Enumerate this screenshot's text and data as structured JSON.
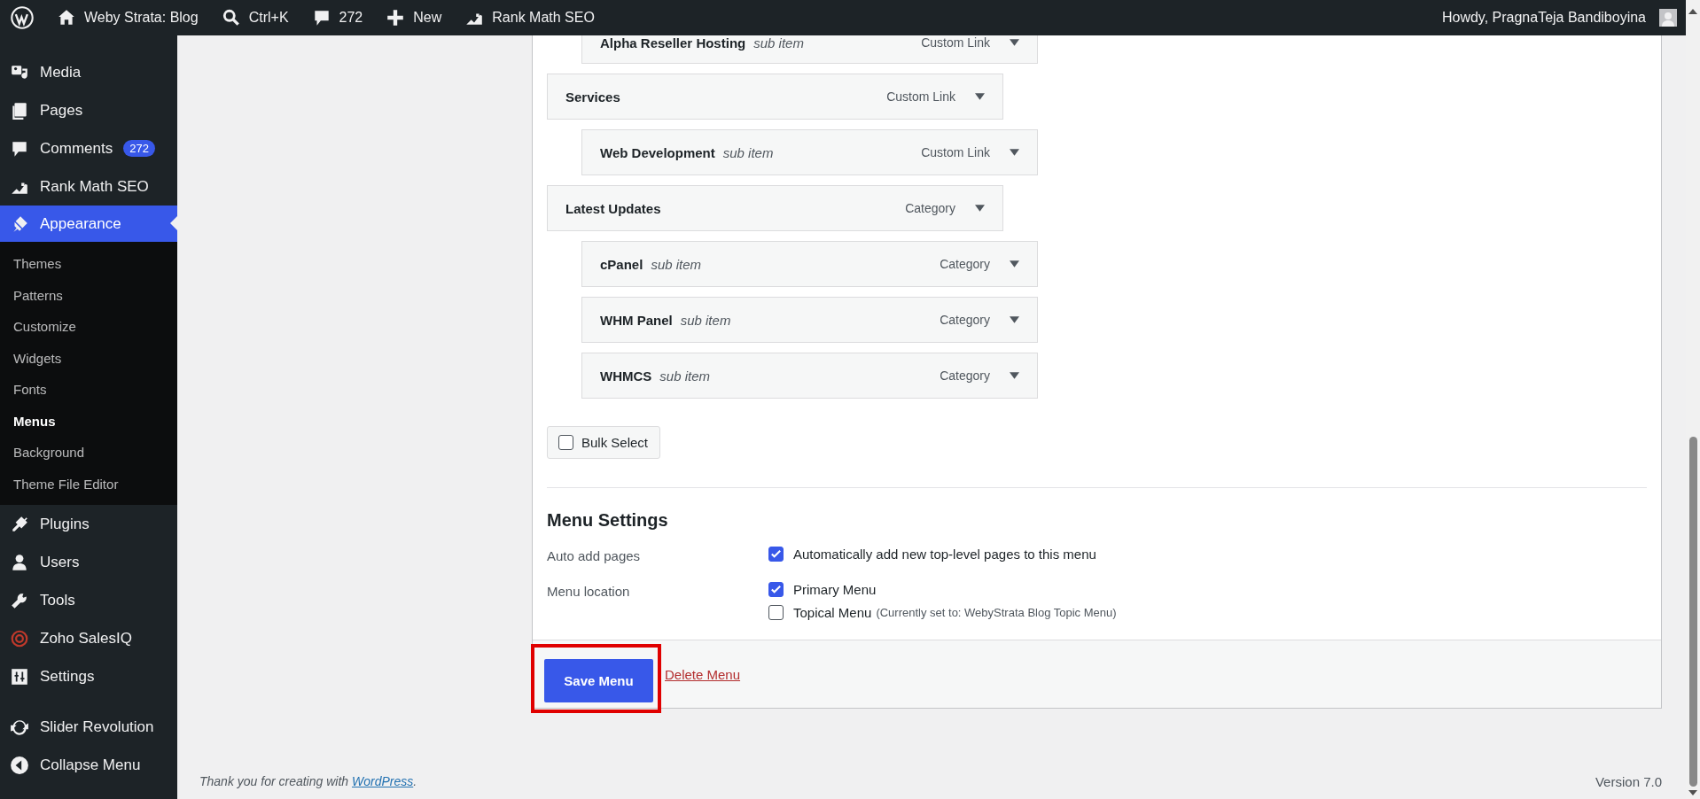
{
  "admin_bar": {
    "site": "Weby Strata: Blog",
    "search": "Ctrl+K",
    "comments": "272",
    "new": "New",
    "seo": "Rank Math SEO",
    "greeting": "Howdy, PragnaTeja Bandiboyina"
  },
  "sidebar": {
    "items": [
      {
        "label": "Media",
        "selected": false
      },
      {
        "label": "Pages",
        "selected": false
      },
      {
        "label": "Comments",
        "badge": "272",
        "selected": false
      },
      {
        "label": "Rank Math SEO",
        "selected": false
      },
      {
        "label": "Appearance",
        "selected": true,
        "children": [
          {
            "label": "Themes",
            "selected": false
          },
          {
            "label": "Patterns",
            "selected": false
          },
          {
            "label": "Customize",
            "selected": false
          },
          {
            "label": "Widgets",
            "selected": false
          },
          {
            "label": "Fonts",
            "selected": false
          },
          {
            "label": "Menus",
            "selected": true
          },
          {
            "label": "Background",
            "selected": false
          },
          {
            "label": "Theme File Editor",
            "selected": false
          }
        ]
      },
      {
        "label": "Plugins",
        "selected": false
      },
      {
        "label": "Users",
        "selected": false
      },
      {
        "label": "Tools",
        "selected": false
      },
      {
        "label": "Zoho SalesIQ",
        "selected": false
      },
      {
        "label": "Settings",
        "selected": false
      },
      {
        "label": "Slider Revolution",
        "selected": false
      }
    ],
    "collapse": "Collapse Menu"
  },
  "menu_items": [
    {
      "children": [
        {
          "title": "Alpha Reseller Hosting",
          "note": "sub item",
          "type": "Custom Link"
        }
      ]
    },
    {
      "title": "Services",
      "type": "Custom Link",
      "children": [
        {
          "title": "Web Development",
          "note": "sub item",
          "type": "Custom Link"
        }
      ]
    },
    {
      "title": "Latest Updates",
      "type": "Category",
      "children": [
        {
          "title": "cPanel",
          "note": "sub item",
          "type": "Category"
        },
        {
          "title": "WHM Panel",
          "note": "sub item",
          "type": "Category"
        },
        {
          "title": "WHMCS",
          "note": "sub item",
          "type": "Category"
        }
      ]
    }
  ],
  "bulk_select": {
    "label": "Bulk Select",
    "checked": false
  },
  "menu_settings": {
    "heading": "Menu Settings",
    "rows": [
      {
        "label": "Auto add pages",
        "options": [
          {
            "label": "Automatically add new top-level pages to this menu",
            "checked": true
          }
        ]
      },
      {
        "label": "Menu location",
        "options": [
          {
            "label": "Primary Menu",
            "checked": true
          },
          {
            "label": "Topical Menu",
            "note": "(Currently set to: WebyStrata Blog Topic Menu)",
            "checked": false
          }
        ]
      }
    ]
  },
  "save_button": "Save Menu",
  "delete_link": "Delete Menu",
  "footer": {
    "before": "Thank you for creating with ",
    "link": "WordPress",
    "after": ".",
    "version": "Version 7.0"
  }
}
